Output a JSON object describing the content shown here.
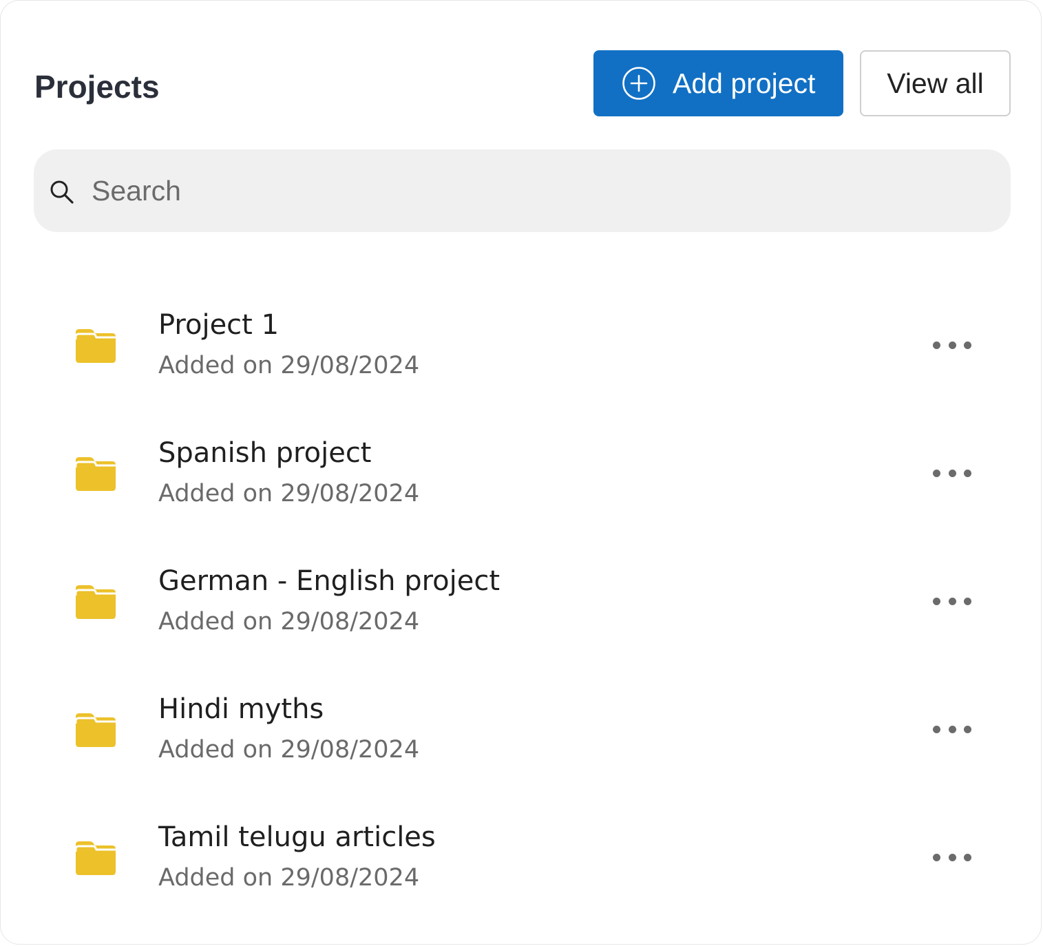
{
  "header": {
    "title": "Projects",
    "add_button_label": "Add project",
    "view_all_label": "View all"
  },
  "search": {
    "placeholder": "Search",
    "value": ""
  },
  "colors": {
    "primary": "#1170c4",
    "folder": "#ecc12a",
    "search_bg": "#f0f0f0",
    "title_text": "#2b2f3a",
    "muted_text": "#6a6a6a"
  },
  "icons": {
    "add": "plus-circle-icon",
    "search": "search-icon",
    "folder": "folder-icon",
    "more": "more-horizontal-icon"
  },
  "projects": [
    {
      "name": "Project 1",
      "date": "Added on 29/08/2024"
    },
    {
      "name": "Spanish project",
      "date": "Added on 29/08/2024"
    },
    {
      "name": "German - English project",
      "date": "Added on 29/08/2024"
    },
    {
      "name": "Hindi myths",
      "date": "Added on 29/08/2024"
    },
    {
      "name": "Tamil telugu articles",
      "date": "Added on 29/08/2024"
    }
  ]
}
